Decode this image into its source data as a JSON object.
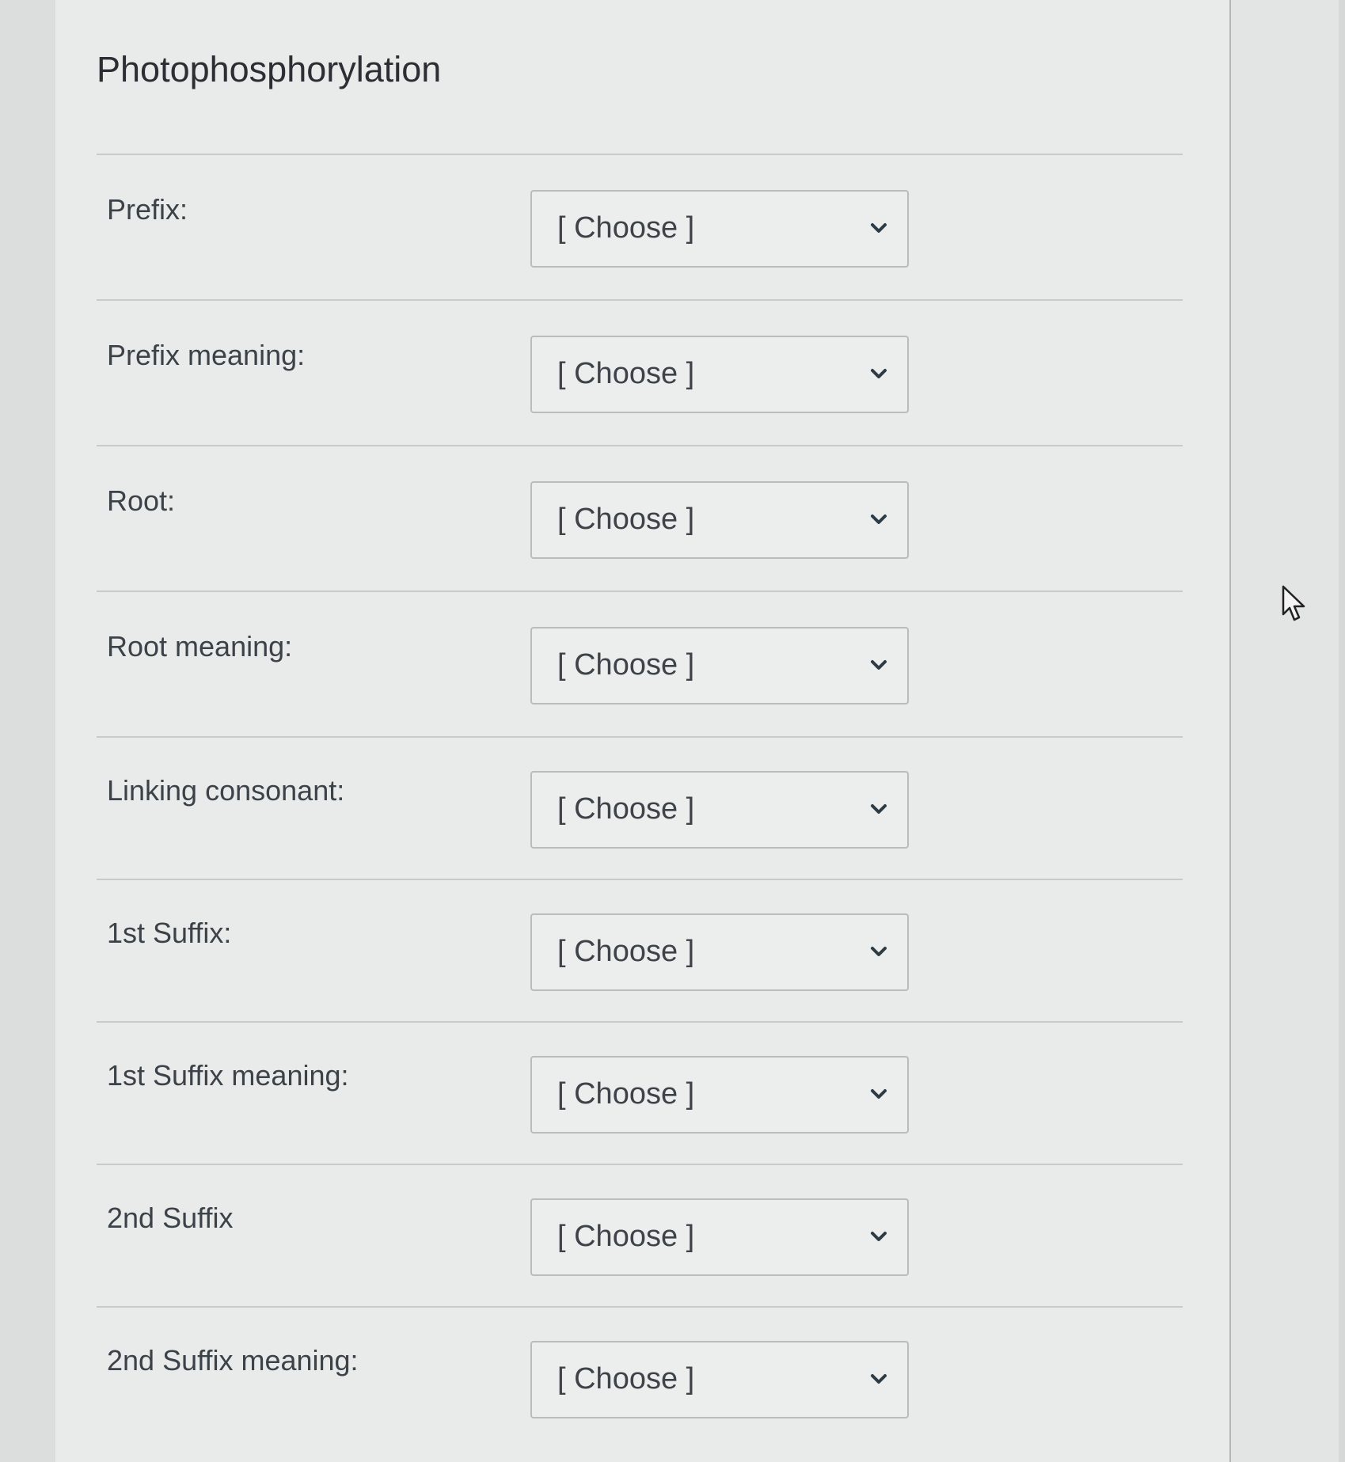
{
  "question": {
    "title": "Photophosphorylation"
  },
  "rows": [
    {
      "label": "Prefix:",
      "value": "[ Choose ]"
    },
    {
      "label": "Prefix meaning:",
      "value": "[ Choose ]"
    },
    {
      "label": "Root:",
      "value": "[ Choose ]"
    },
    {
      "label": "Root meaning:",
      "value": "[ Choose ]"
    },
    {
      "label": "Linking consonant:",
      "value": "[ Choose ]"
    },
    {
      "label": "1st Suffix:",
      "value": "[ Choose ]"
    },
    {
      "label": "1st Suffix meaning:",
      "value": "[ Choose ]"
    },
    {
      "label": "2nd Suffix",
      "value": "[ Choose ]"
    },
    {
      "label": "2nd Suffix meaning:",
      "value": "[ Choose ]"
    }
  ],
  "icons": {
    "dropdown": "chevron-down-icon",
    "pointer": "mouse-cursor-icon"
  }
}
